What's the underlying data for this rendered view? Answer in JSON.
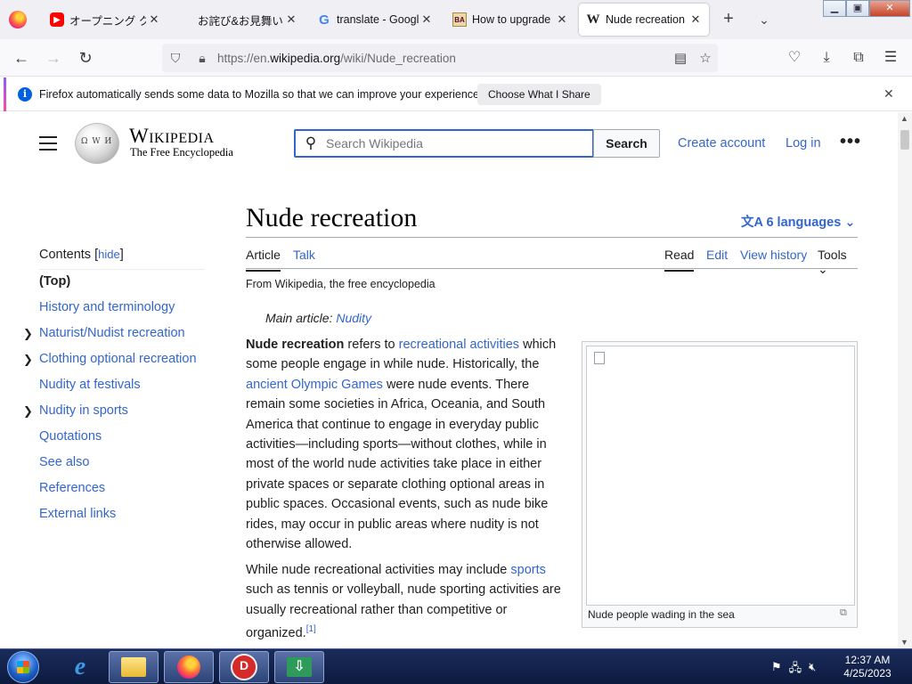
{
  "browser": {
    "tabs": [
      {
        "title": "オープニング ク",
        "favicon": "youtube",
        "active": false
      },
      {
        "title": "お詫び&お見舞い集",
        "favicon": "none",
        "active": false
      },
      {
        "title": "translate - Google",
        "favicon": "google",
        "active": false
      },
      {
        "title": "How to upgrade",
        "favicon": "ba",
        "active": false
      },
      {
        "title": "Nude recreation -",
        "favicon": "wikipedia",
        "active": true
      }
    ],
    "new_tab_symbol": "+",
    "url_prefix": "https://en.",
    "url_domain": "wikipedia.org",
    "url_path": "/wiki/Nude_recreation"
  },
  "notification": {
    "message": "Firefox automatically sends some data to Mozilla so that we can improve your experience.",
    "button": "Choose What I Share"
  },
  "wiki": {
    "wordmark": "Wikipedia",
    "tagline": "The Free Encyclopedia",
    "search_placeholder": "Search Wikipedia",
    "search_button": "Search",
    "create_account": "Create account",
    "log_in": "Log in"
  },
  "toc": {
    "title": "Contents",
    "hide": "hide",
    "items": [
      {
        "label": "(Top)",
        "expandable": false
      },
      {
        "label": "History and terminology",
        "expandable": false
      },
      {
        "label": "Naturist/Nudist recreation",
        "expandable": true
      },
      {
        "label": "Clothing optional recreation",
        "expandable": true
      },
      {
        "label": "Nudity at festivals",
        "expandable": false
      },
      {
        "label": "Nudity in sports",
        "expandable": true
      },
      {
        "label": "Quotations",
        "expandable": false
      },
      {
        "label": "See also",
        "expandable": false
      },
      {
        "label": "References",
        "expandable": false
      },
      {
        "label": "External links",
        "expandable": false
      }
    ]
  },
  "article": {
    "title": "Nude recreation",
    "languages": "6 languages",
    "tabs": {
      "article": "Article",
      "talk": "Talk",
      "read": "Read",
      "edit": "Edit",
      "history": "View history",
      "tools": "Tools"
    },
    "from_wikipedia": "From Wikipedia, the free encyclopedia",
    "hatnote_prefix": "Main article: ",
    "hatnote_link": "Nudity",
    "p1": {
      "bold": "Nude recreation",
      "t1": " refers to ",
      "l1": "recreational activities",
      "t2": " which some people engage in while nude. Historically, the ",
      "l2": "ancient Olympic Games",
      "t3": " were nude events. There remain some societies in Africa, Oceania, and South America that continue to engage in everyday public activities—including sports—without clothes, while in most of the world nude activities take place in either private spaces or separate clothing optional areas in public spaces. Occasional events, such as nude bike rides, may occur in public areas where nudity is not otherwise allowed."
    },
    "p2": {
      "t1": "While nude recreational activities may include ",
      "l1": "sports",
      "t2": " such as tennis or volleyball, nude sporting activities are usually recreational rather than competitive or organized.",
      "ref": "[1]"
    },
    "figure_caption": "Nude people wading in the sea"
  },
  "taskbar": {
    "time": "12:37 AM",
    "date": "4/25/2023"
  }
}
